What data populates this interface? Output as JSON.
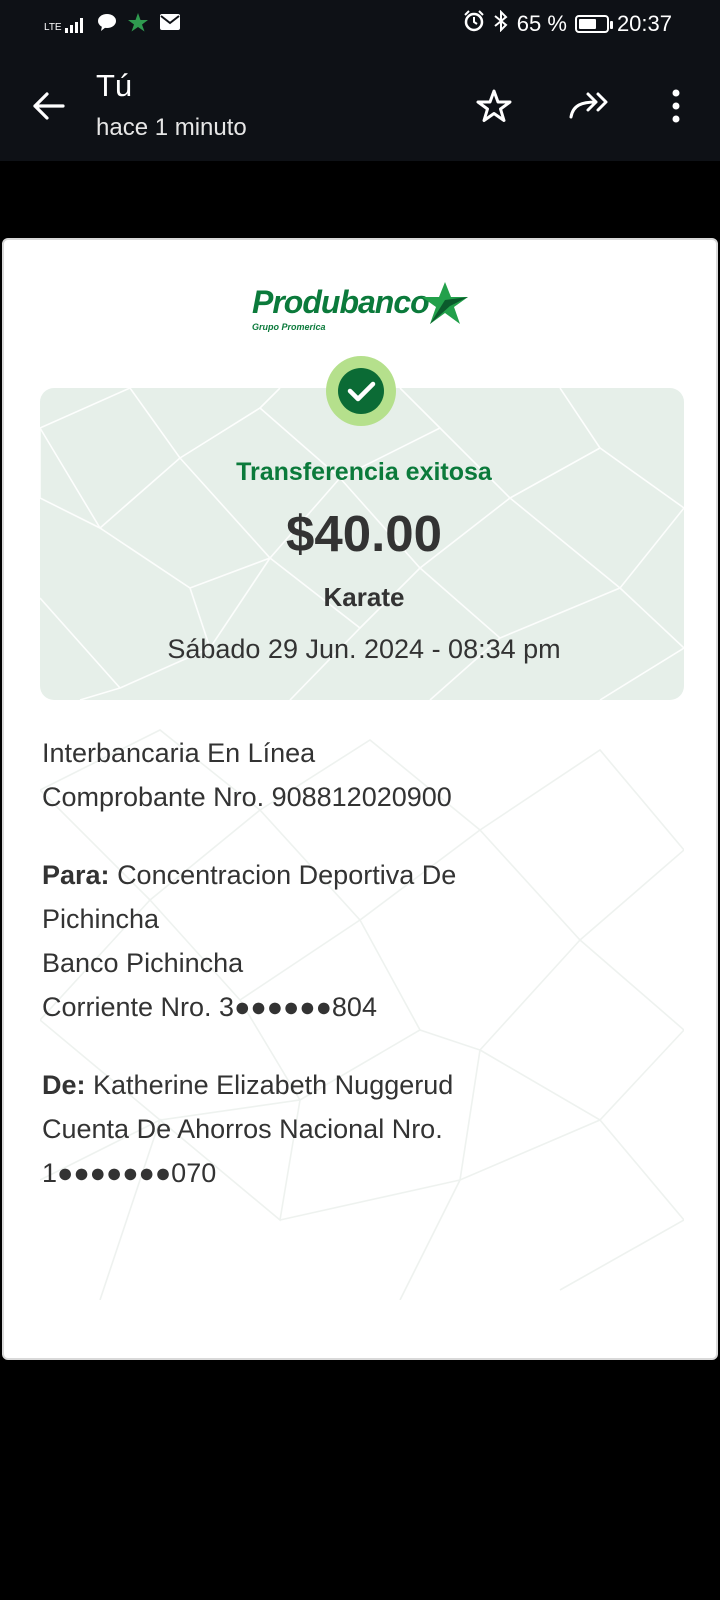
{
  "status_bar": {
    "network": "LTE",
    "battery_percent": "65 %",
    "battery_level": 0.65,
    "time": "20:37"
  },
  "header": {
    "title": "Tú",
    "subtitle": "hace 1 minuto",
    "icons": [
      "back-arrow-icon",
      "star-icon",
      "forward-icon",
      "more-vert-icon"
    ]
  },
  "receipt": {
    "brand": "Produbanco",
    "brand_sub": "Grupo Promerica",
    "status": "Transferencia exitosa",
    "amount": "$40.00",
    "concept": "Karate",
    "datetime": "Sábado 29 Jun. 2024 - 08:34 pm",
    "type": "Interbancaria En Línea",
    "voucher": "Comprobante Nro. 908812020900",
    "to_label": "Para:",
    "to_name_line1": "Concentracion Deportiva De",
    "to_name_line2": "Pichincha",
    "to_bank": "Banco Pichincha",
    "to_account": "Corriente Nro. 3●●●●●●804",
    "from_label": "De:",
    "from_name": "Katherine Elizabeth Nuggerud",
    "from_account_line1": "Cuenta De Ahorros Nacional Nro.",
    "from_account_line2": "1●●●●●●●070"
  },
  "colors": {
    "brand_green": "#0b7a3b",
    "check_ring": "#b5e08c",
    "success_bg": "#e6efe9",
    "app_bar": "#0e1116"
  }
}
